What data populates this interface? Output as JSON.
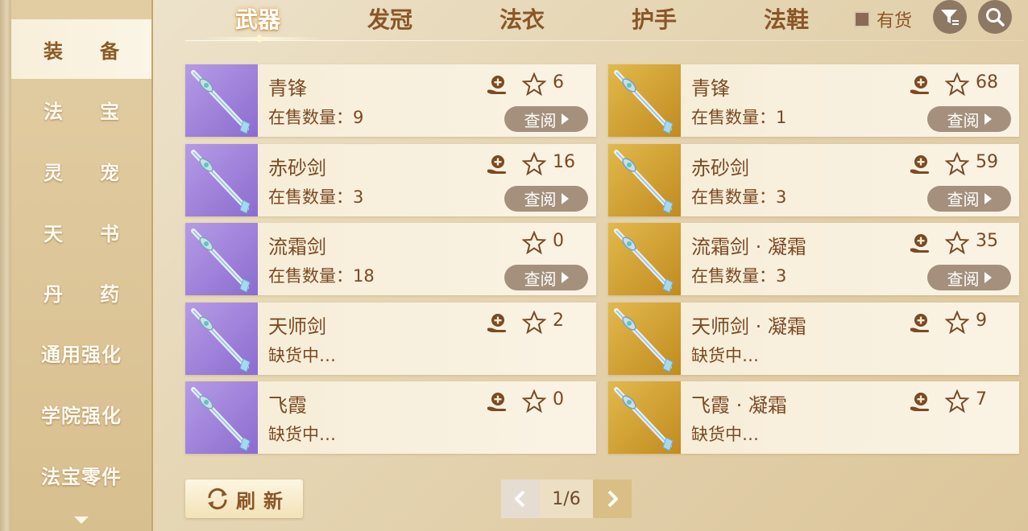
{
  "sidebar": {
    "items": [
      {
        "label": "装备",
        "active": true
      },
      {
        "label": "法宝"
      },
      {
        "label": "灵宠"
      },
      {
        "label": "天书"
      },
      {
        "label": "丹药"
      },
      {
        "label": "通用强化"
      },
      {
        "label": "学院强化"
      },
      {
        "label": "法宝零件"
      }
    ]
  },
  "tabs": [
    {
      "label": "武器",
      "active": true
    },
    {
      "label": "发冠"
    },
    {
      "label": "法衣"
    },
    {
      "label": "护手"
    },
    {
      "label": "法鞋"
    }
  ],
  "header": {
    "stock_filter_label": "有货"
  },
  "items": [
    {
      "name": "青锋",
      "status": "在售数量：9",
      "count": "6",
      "thumb": "purple",
      "cart": true,
      "view": "查阅"
    },
    {
      "name": "赤砂剑",
      "status": "在售数量：3",
      "count": "16",
      "thumb": "purple",
      "cart": true,
      "view": "查阅"
    },
    {
      "name": "流霜剑",
      "status": "在售数量：18",
      "count": "0",
      "thumb": "purple",
      "cart": false,
      "view": "查阅"
    },
    {
      "name": "天师剑",
      "status": "缺货中…",
      "count": "2",
      "thumb": "purple",
      "cart": true,
      "view": ""
    },
    {
      "name": "飞霞",
      "status": "缺货中…",
      "count": "0",
      "thumb": "purple",
      "cart": true,
      "view": ""
    },
    {
      "name": "青锋",
      "status": "在售数量：1",
      "count": "68",
      "thumb": "gold",
      "cart": true,
      "view": "查阅"
    },
    {
      "name": "赤砂剑",
      "status": "在售数量：3",
      "count": "59",
      "thumb": "gold",
      "cart": true,
      "view": "查阅"
    },
    {
      "name": "流霜剑 · 凝霜",
      "status": "在售数量：3",
      "count": "35",
      "thumb": "gold",
      "cart": true,
      "view": "查阅"
    },
    {
      "name": "天师剑 · 凝霜",
      "status": "缺货中…",
      "count": "9",
      "thumb": "gold",
      "cart": true,
      "view": ""
    },
    {
      "name": "飞霞 · 凝霜",
      "status": "缺货中…",
      "count": "7",
      "thumb": "gold",
      "cart": true,
      "view": ""
    }
  ],
  "footer": {
    "refresh_label": "刷新",
    "page": "1/6"
  },
  "icons": {
    "cart": "hand-plus-icon",
    "star": "star-outline-icon",
    "filter": "filter-icon",
    "search": "search-icon",
    "refresh": "refresh-icon"
  },
  "colors": {
    "accent": "#8a5628",
    "view_button": "#a4907c",
    "purple_tile": "#9f84da",
    "gold_tile": "#d4a437"
  }
}
